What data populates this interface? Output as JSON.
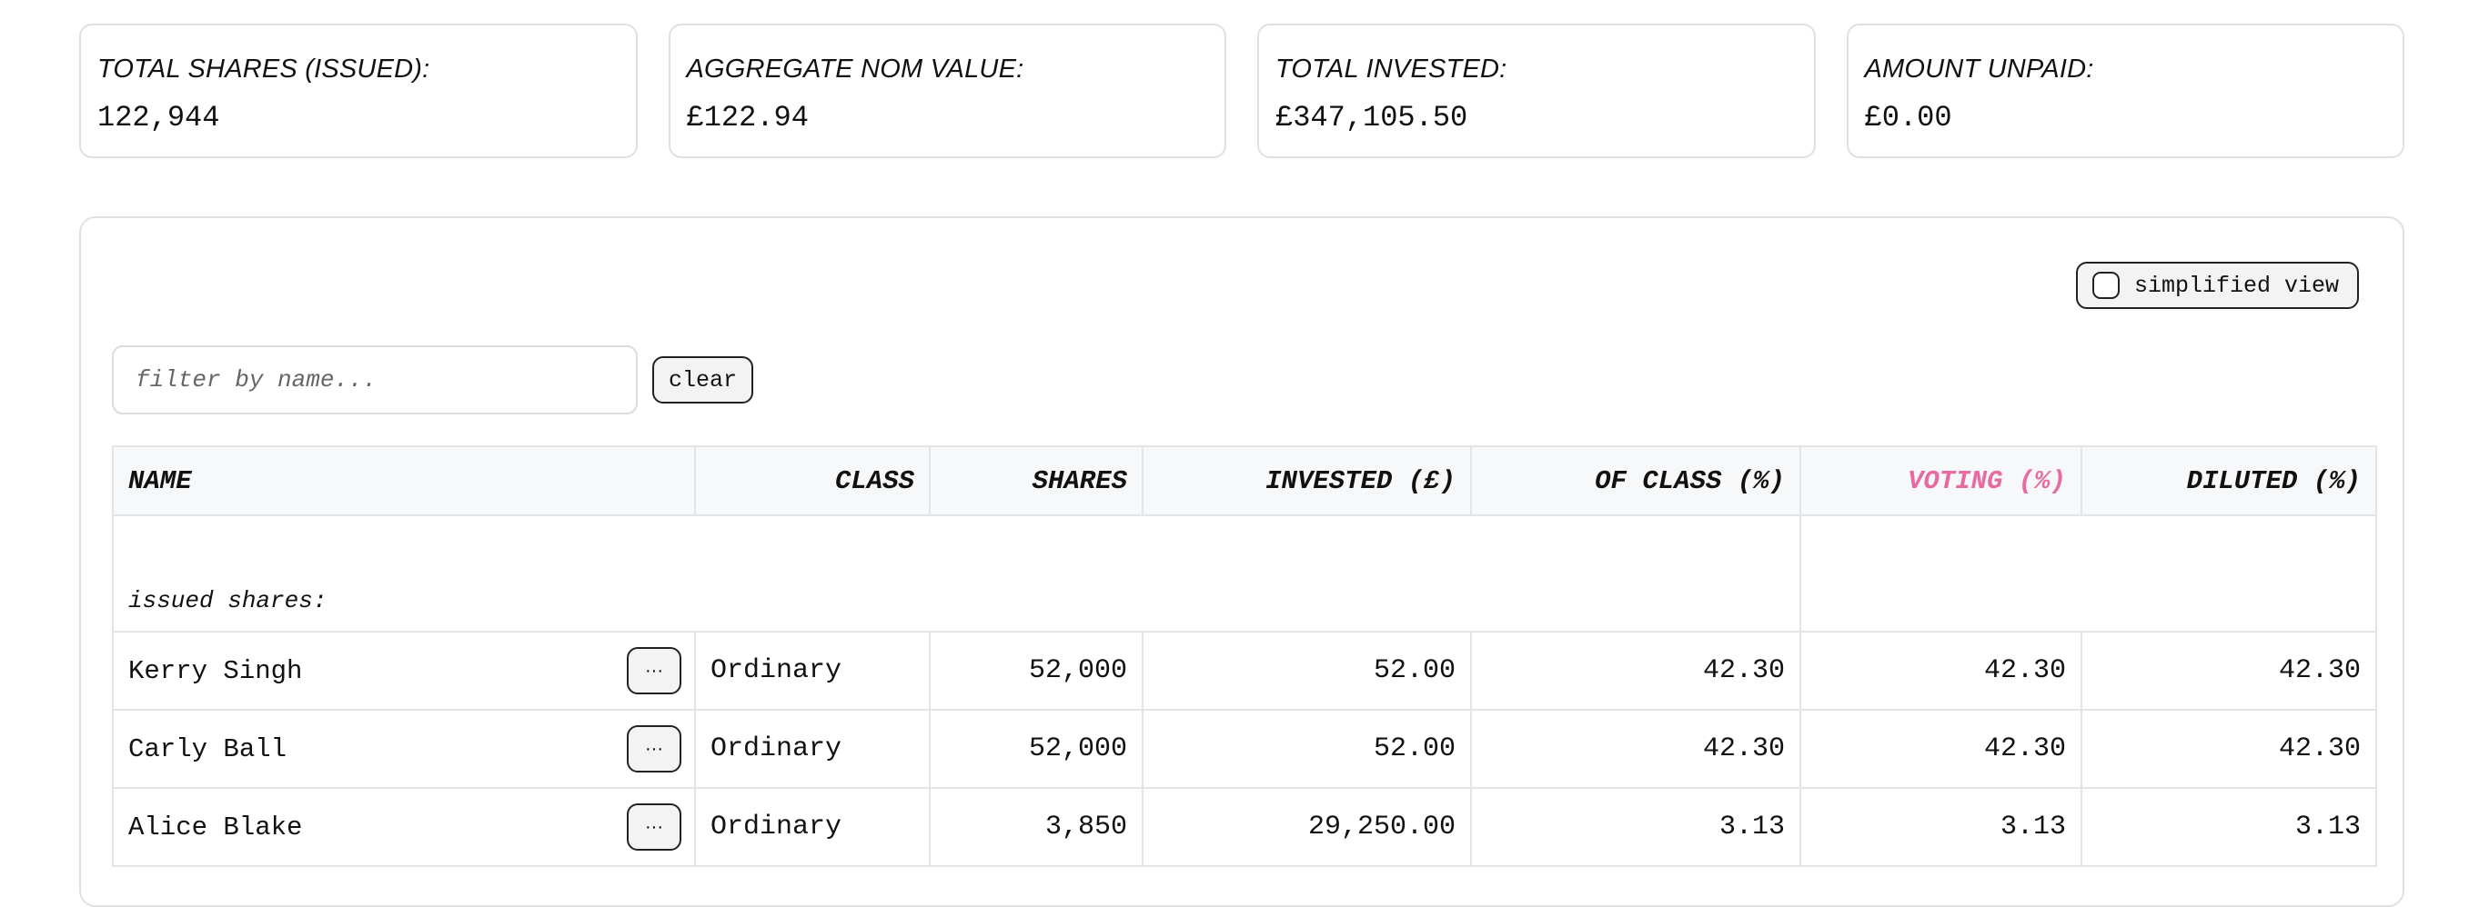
{
  "summary": {
    "total_shares": {
      "label": "TOTAL SHARES (ISSUED):",
      "value": "122,944"
    },
    "aggregate_nom_value": {
      "label": "AGGREGATE NOM VALUE:",
      "value": "£122.94"
    },
    "total_invested": {
      "label": "TOTAL INVESTED:",
      "value": "£347,105.50"
    },
    "amount_unpaid": {
      "label": "AMOUNT UNPAID:",
      "value": "£0.00"
    }
  },
  "toolbar": {
    "simplified_view_label": "simplified view",
    "filter_placeholder": "filter by name...",
    "clear_label": "clear"
  },
  "table": {
    "columns": [
      "NAME",
      "CLASS",
      "SHARES",
      "INVESTED (£)",
      "OF CLASS (%)",
      "VOTING (%)",
      "DILUTED (%)"
    ],
    "section_label": "issued shares:",
    "more_label": "···",
    "rows": [
      {
        "name": "Kerry Singh",
        "class": "Ordinary",
        "shares": "52,000",
        "invested": "52.00",
        "of_class": "42.30",
        "voting": "42.30",
        "diluted": "42.30"
      },
      {
        "name": "Carly Ball",
        "class": "Ordinary",
        "shares": "52,000",
        "invested": "52.00",
        "of_class": "42.30",
        "voting": "42.30",
        "diluted": "42.30"
      },
      {
        "name": "Alice Blake",
        "class": "Ordinary",
        "shares": "3,850",
        "invested": "29,250.00",
        "of_class": "3.13",
        "voting": "3.13",
        "diluted": "3.13"
      }
    ]
  },
  "colors": {
    "voting_accent": "#e86aa0",
    "border": "#e2e4e6",
    "header_bg": "#f7f8f9"
  }
}
